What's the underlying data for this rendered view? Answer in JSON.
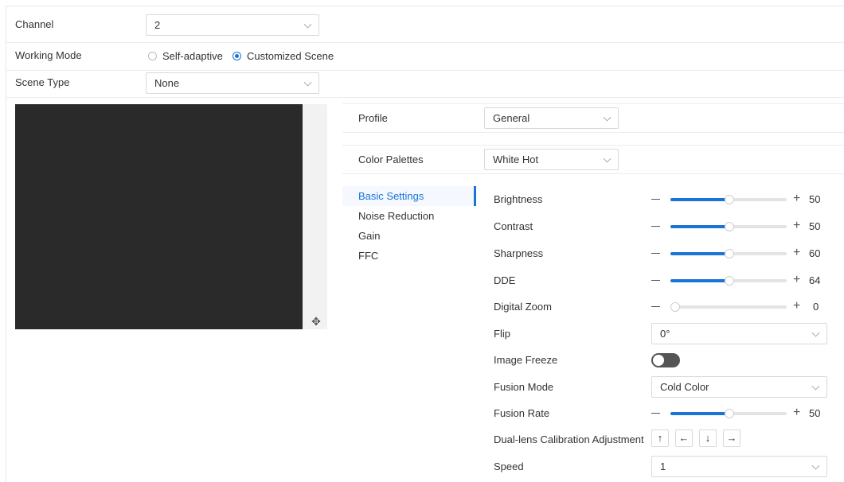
{
  "channel": {
    "label": "Channel",
    "value": "2"
  },
  "working_mode": {
    "label": "Working Mode",
    "options": [
      "Self-adaptive",
      "Customized Scene"
    ],
    "selected": "Customized Scene"
  },
  "scene_type": {
    "label": "Scene Type",
    "value": "None"
  },
  "profile": {
    "label": "Profile",
    "value": "General"
  },
  "color_palettes": {
    "label": "Color Palettes",
    "value": "White Hot"
  },
  "nav": {
    "items": [
      "Basic Settings",
      "Noise Reduction",
      "Gain",
      "FFC"
    ],
    "active": "Basic Settings"
  },
  "settings": {
    "brightness": {
      "label": "Brightness",
      "value": "50",
      "fraction": 0.5
    },
    "contrast": {
      "label": "Contrast",
      "value": "50",
      "fraction": 0.5
    },
    "sharpness": {
      "label": "Sharpness",
      "value": "60",
      "fraction": 0.5
    },
    "dde": {
      "label": "DDE",
      "value": "64",
      "fraction": 0.5
    },
    "digital_zoom": {
      "label": "Digital Zoom",
      "value": "0",
      "fraction": 0.0
    },
    "flip": {
      "label": "Flip",
      "value": "0°"
    },
    "image_freeze": {
      "label": "Image Freeze",
      "on": false
    },
    "fusion_mode": {
      "label": "Fusion Mode",
      "value": "Cold Color"
    },
    "fusion_rate": {
      "label": "Fusion Rate",
      "value": "50",
      "fraction": 0.5
    },
    "dual_lens": {
      "label": "Dual-lens Calibration Adjustment",
      "buttons": [
        "↑",
        "←",
        "↓",
        "→"
      ]
    },
    "speed": {
      "label": "Speed",
      "value": "1"
    }
  },
  "colors": {
    "accent": "#1a73d9",
    "toggle_off": "#555555"
  }
}
